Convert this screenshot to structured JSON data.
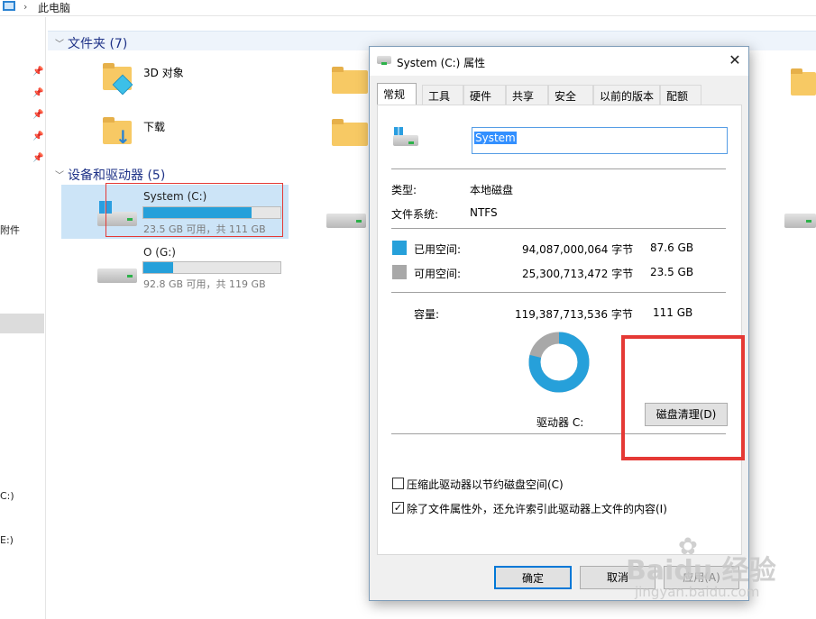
{
  "explorer": {
    "breadcrumb": {
      "location": "此电脑"
    },
    "sidebar": {
      "items": [
        {
          "label": "附件"
        },
        {
          "label": "C:)"
        },
        {
          "label": "E:)"
        }
      ]
    },
    "folders_group": {
      "title": "文件夹 (7)",
      "items": [
        {
          "label": "3D 对象"
        },
        {
          "label": "下载"
        }
      ]
    },
    "drives_group": {
      "title": "设备和驱动器 (5)",
      "drives": [
        {
          "name": "System (C:)",
          "info": "23.5 GB 可用，共 111 GB",
          "used_fraction": 0.79
        },
        {
          "name": "O (G:)",
          "info": "92.8 GB 可用，共 119 GB",
          "used_fraction": 0.22
        }
      ]
    }
  },
  "dialog": {
    "title": "System (C:) 属性",
    "close_symbol": "✕",
    "tabs": [
      {
        "label": "常规"
      },
      {
        "label": "工具"
      },
      {
        "label": "硬件"
      },
      {
        "label": "共享"
      },
      {
        "label": "安全"
      },
      {
        "label": "以前的版本"
      },
      {
        "label": "配额"
      }
    ],
    "volume_name": "System",
    "type_label": "类型:",
    "type_value": "本地磁盘",
    "fs_label": "文件系统:",
    "fs_value": "NTFS",
    "used_label": "已用空间:",
    "used_bytes": "94,087,000,064 字节",
    "used_size": "87.6 GB",
    "free_label": "可用空间:",
    "free_bytes": "25,300,713,472 字节",
    "free_size": "23.5 GB",
    "capacity_label": "容量:",
    "capacity_bytes": "119,387,713,536 字节",
    "capacity_size": "111 GB",
    "drive_label": "驱动器 C:",
    "cleanup_button": "磁盘清理(D)",
    "compress_label": "压缩此驱动器以节约磁盘空间(C)",
    "compress_checked": false,
    "index_label": "除了文件属性外，还允许索引此驱动器上文件的内容(I)",
    "index_checked": true,
    "check_mark": "✓",
    "ok_button": "确定",
    "cancel_button": "取消",
    "apply_button": "应用(A)",
    "used_fraction": 0.788,
    "colors": {
      "used": "#26a0da",
      "free": "#a8a8a8",
      "highlight": "#e53935"
    }
  },
  "watermark": {
    "brand": "Baidu 经验",
    "url": "jingyan.baidu.com"
  }
}
